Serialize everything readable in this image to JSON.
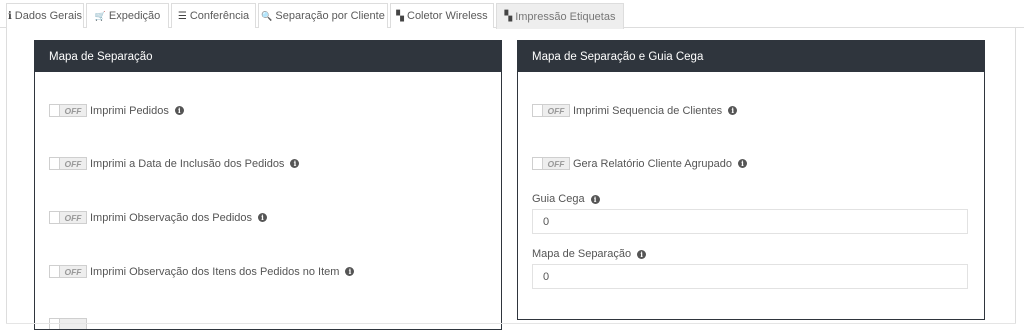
{
  "tabs": [
    {
      "label": "Dados Gerais",
      "icon": "info-icon",
      "glyph": "i",
      "active": false
    },
    {
      "label": "Expedição",
      "icon": "cart-icon",
      "glyph": "🛒",
      "active": false
    },
    {
      "label": "Conferência",
      "icon": "list-icon",
      "glyph": "☰",
      "active": false
    },
    {
      "label": "Separação por Cliente",
      "icon": "search-icon",
      "glyph": "🔍",
      "active": false
    },
    {
      "label": "Coletor Wireless",
      "icon": "map-icon",
      "glyph": "▚",
      "active": false
    },
    {
      "label": "Impressão Etiquetas",
      "icon": "map-icon",
      "glyph": "▚",
      "active": true
    }
  ],
  "toggle_off_text": "OFF",
  "info_glyph": "i",
  "left_panel": {
    "title": "Mapa de Separação",
    "options": [
      {
        "label": "Imprimi Pedidos",
        "state": "OFF"
      },
      {
        "label": "Imprimi a Data de Inclusão dos Pedidos",
        "state": "OFF"
      },
      {
        "label": "Imprimi Observação dos Pedidos",
        "state": "OFF"
      },
      {
        "label": "Imprimi Observação dos Itens dos Pedidos no Item",
        "state": "OFF"
      }
    ]
  },
  "right_panel": {
    "title": "Mapa de Separação e Guia Cega",
    "options": [
      {
        "label": "Imprimi Sequencia de Clientes",
        "state": "OFF"
      },
      {
        "label": "Gera Relatório Cliente Agrupado",
        "state": "OFF"
      }
    ],
    "fields": [
      {
        "label": "Guia Cega",
        "value": "0"
      },
      {
        "label": "Mapa de Separação",
        "value": "0"
      }
    ]
  }
}
